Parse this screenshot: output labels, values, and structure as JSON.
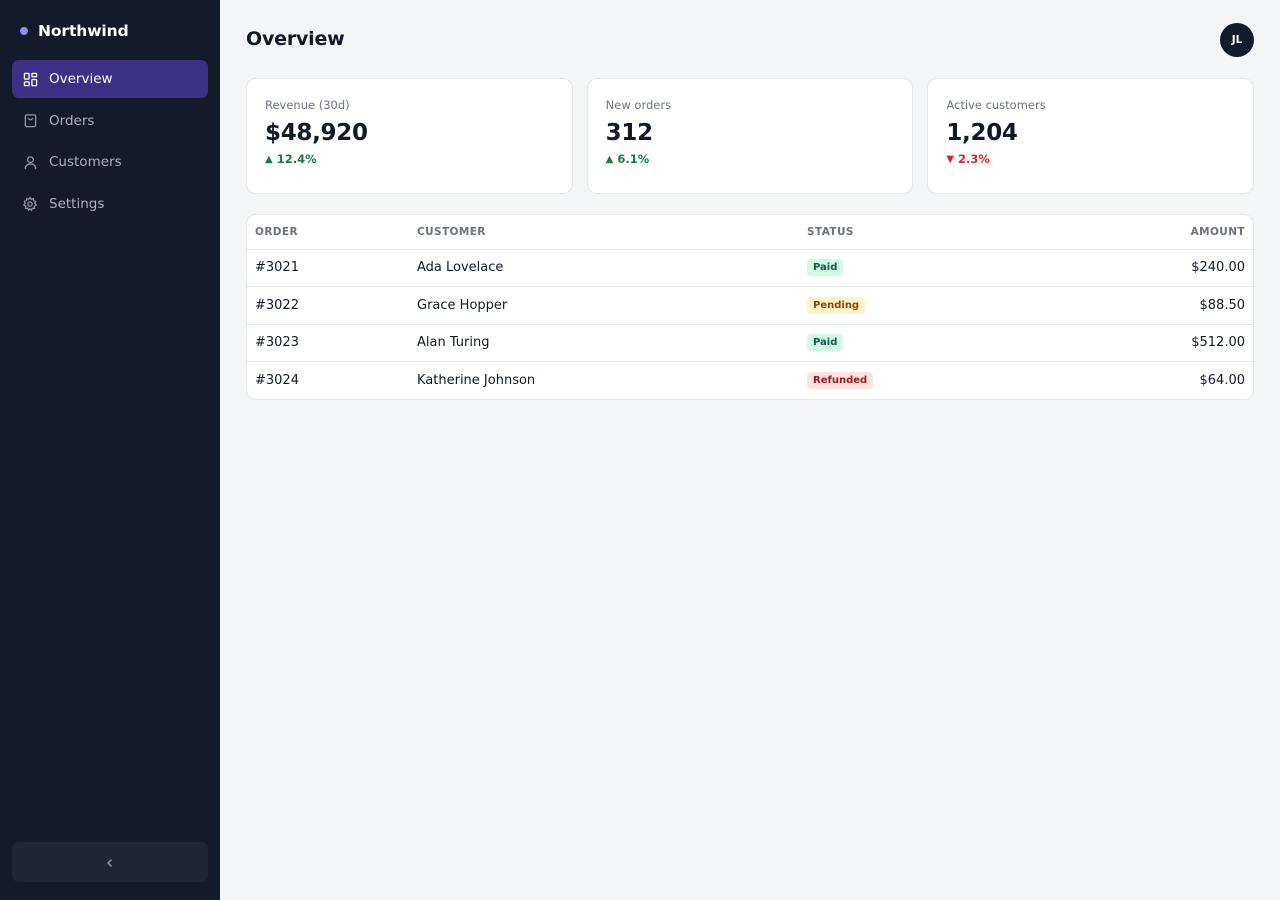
{
  "app": {
    "name": "Northwind"
  },
  "sidebar": {
    "items": [
      {
        "label": "Overview",
        "icon": "dashboard-icon",
        "active": true
      },
      {
        "label": "Orders",
        "icon": "bag-icon",
        "active": false
      },
      {
        "label": "Customers",
        "icon": "user-icon",
        "active": false
      },
      {
        "label": "Settings",
        "icon": "gear-icon",
        "active": false
      }
    ],
    "collapse_icon": "chevron-left-icon"
  },
  "header": {
    "title": "Overview",
    "avatar_initials": "JL"
  },
  "stats": [
    {
      "label": "Revenue (30d)",
      "value": "$48,920",
      "delta": "12.4%",
      "trend": "up"
    },
    {
      "label": "New orders",
      "value": "312",
      "delta": "6.1%",
      "trend": "up"
    },
    {
      "label": "Active customers",
      "value": "1,204",
      "delta": "2.3%",
      "trend": "down"
    }
  ],
  "orders": {
    "columns": [
      "ORDER",
      "CUSTOMER",
      "STATUS",
      "AMOUNT"
    ],
    "rows": [
      {
        "order": "#3021",
        "customer": "Ada Lovelace",
        "status": "Paid",
        "amount": "$240.00"
      },
      {
        "order": "#3022",
        "customer": "Grace Hopper",
        "status": "Pending",
        "amount": "$88.50"
      },
      {
        "order": "#3023",
        "customer": "Alan Turing",
        "status": "Paid",
        "amount": "$512.00"
      },
      {
        "order": "#3024",
        "customer": "Katherine Johnson",
        "status": "Refunded",
        "amount": "$64.00"
      }
    ]
  },
  "colors": {
    "sidebar_bg": "#131a2a",
    "accent": "#3c2f86",
    "brand_dot": "#8b8cf5",
    "positive": "#15803d",
    "negative": "#dc2626"
  }
}
